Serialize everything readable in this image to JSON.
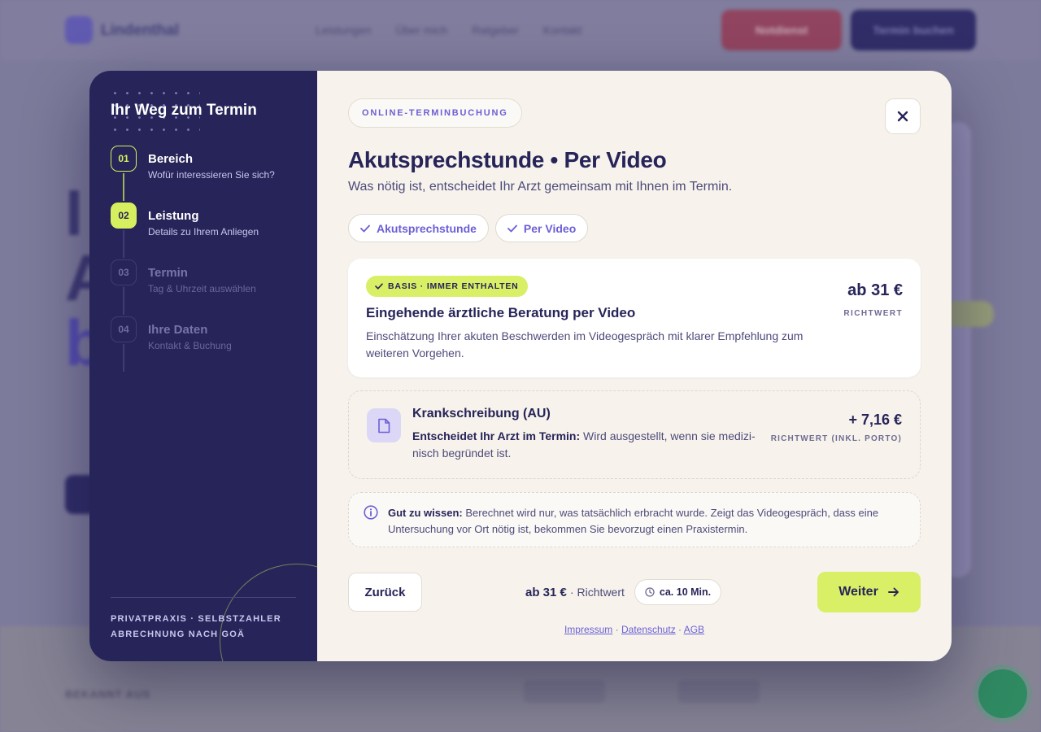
{
  "background": {
    "brand": "Lindenthal",
    "nav": [
      "Leistungen",
      "Über mich",
      "Ratgeber",
      "Kontakt"
    ],
    "emergency_label": "Notdienst",
    "book_label": "Termin buchen",
    "footer_text": "BEKANNT AUS"
  },
  "sidebar": {
    "title": "Ihr Weg zum Termin",
    "steps": [
      {
        "num": "01",
        "title": "Bereich",
        "sub": "Wofür interessieren Sie sich?",
        "state": "done"
      },
      {
        "num": "02",
        "title": "Leistung",
        "sub": "Details zu Ihrem Anliegen",
        "state": "active"
      },
      {
        "num": "03",
        "title": "Termin",
        "sub": "Tag & Uhrzeit auswählen",
        "state": "todo"
      },
      {
        "num": "04",
        "title": "Ihre Daten",
        "sub": "Kontakt & Buchung",
        "state": "todo"
      }
    ],
    "footer_line1": "PRIVATPRAXIS · SELBSTZAHLER",
    "footer_line2": "ABRECHNUNG NACH GOÄ"
  },
  "main": {
    "eyebrow": "ONLINE-TERMINBUCHUNG",
    "heading": "Akutsprechstunde • Per Video",
    "lead": "Was nötig ist, entscheidet Ihr Arzt gemeinsam mit Ihnen im Termin.",
    "tags": [
      "Akutsprechstunde",
      "Per Video"
    ],
    "basis": {
      "badge": "BASIS · IMMER ENTHALTEN",
      "title": "Eingehende ärztliche Beratung per Video",
      "desc": "Einschätzung Ihrer akuten Beschwerden im Videogespräch mit klarer Empfehlung zum weiteren Vorgehen.",
      "price": "ab 31 €",
      "price_note": "RICHTWERT"
    },
    "au": {
      "title": "Krankschreibung (AU)",
      "desc_bold": "Entscheidet Ihr Arzt im Termin:",
      "desc": " Wird ausgestellt, wenn sie medizi-nisch begründet ist.",
      "price": "+ 7,16 €",
      "price_note": "RICHTWERT (INKL. PORTO)"
    },
    "info": {
      "bold": "Gut zu wissen:",
      "text": " Berechnet wird nur, was tatsächlich erbracht wurde. Zeigt das Videogespräch, dass eine Untersuchung vor Ort nötig ist, bekommen Sie bevorzugt einen Praxistermin."
    },
    "back_label": "Zurück",
    "summary_price": "ab 31 €",
    "summary_sep": "·",
    "summary_note": "Richtwert",
    "duration": "ca. 10 Min.",
    "next_label": "Weiter",
    "links": [
      "Impressum",
      "Datenschutz",
      "AGB"
    ],
    "link_sep": "·"
  },
  "colors": {
    "navy": "#272459",
    "lime": "#d8ef66",
    "violet": "#6b5fd6",
    "cream": "#f7f3ec"
  },
  "icons": [
    "check-icon",
    "close-icon",
    "document-icon",
    "info-icon",
    "clock-icon",
    "arrow-right-icon"
  ]
}
